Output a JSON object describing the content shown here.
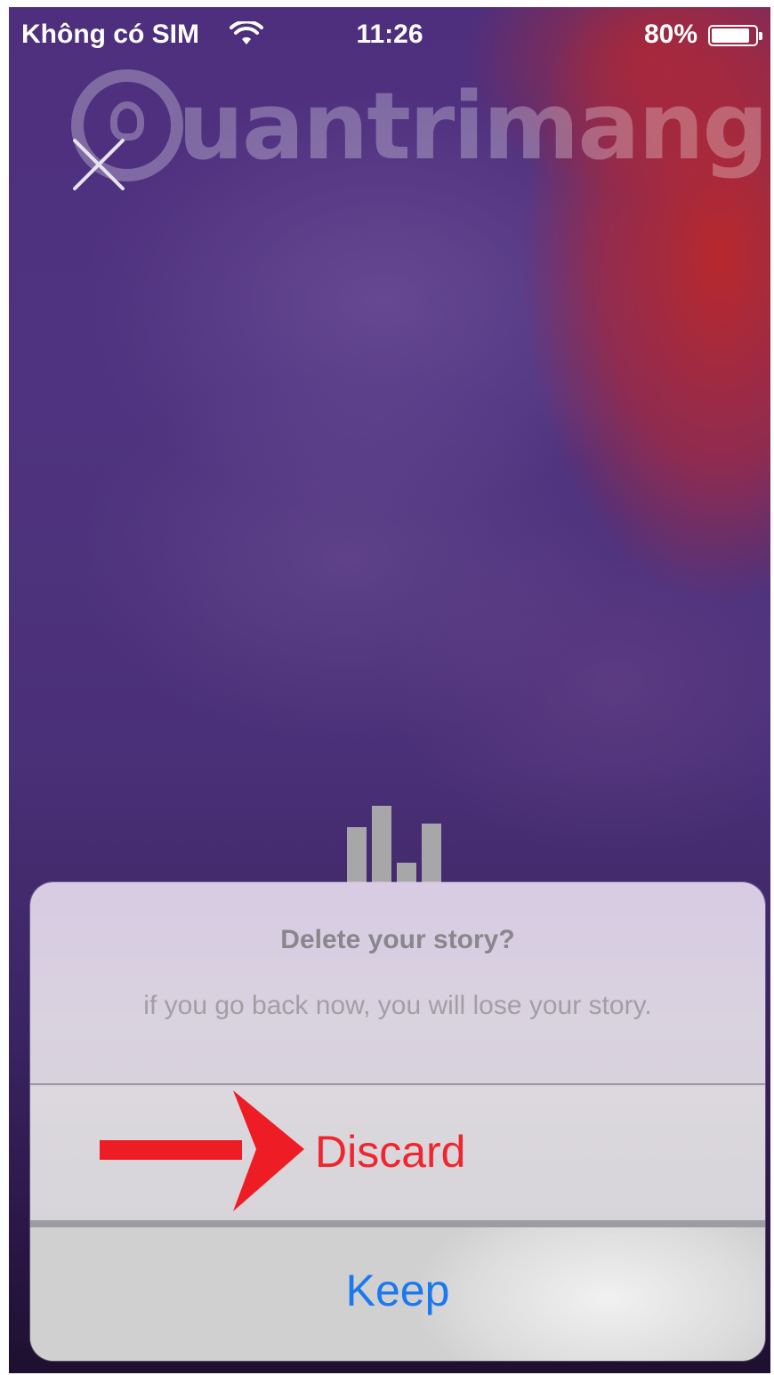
{
  "status_bar": {
    "carrier": "Không có SIM",
    "time": "11:26",
    "battery_percent": "80%",
    "battery_level": 0.8
  },
  "watermark": {
    "text": "uantrimang"
  },
  "dialog": {
    "title": "Delete your story?",
    "message": "if you go back now, you will lose your story.",
    "discard_label": "Discard",
    "keep_label": "Keep"
  },
  "colors": {
    "discard": "#f0262e",
    "keep": "#1a78f0",
    "annotation_arrow": "#ee1c24"
  },
  "icons": {
    "close": "close-icon",
    "bars": "bar-chart-icon",
    "wifi": "wifi-icon",
    "battery": "battery-icon",
    "annotation": "red-arrow"
  }
}
